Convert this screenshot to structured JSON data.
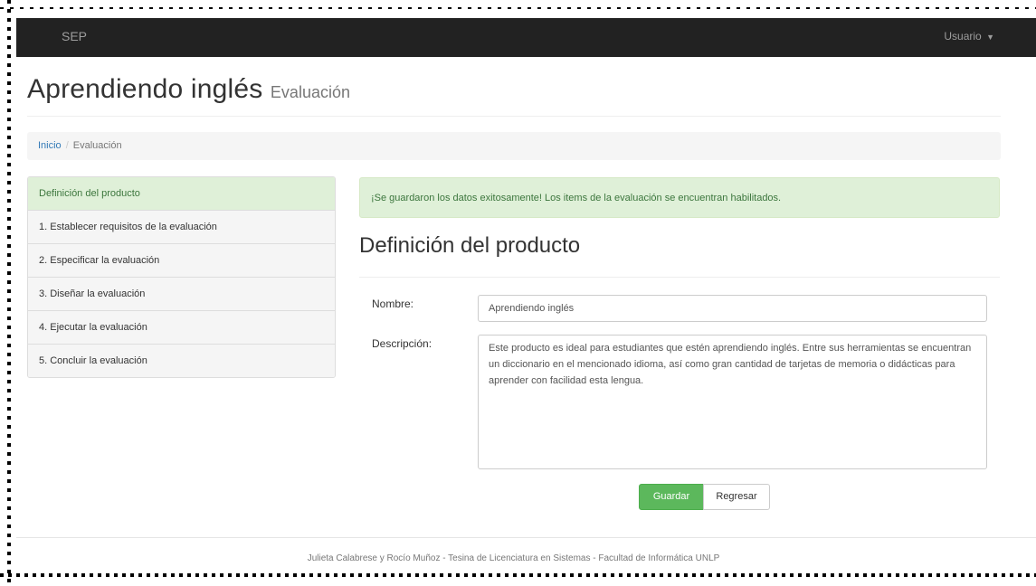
{
  "navbar": {
    "brand": "SEP",
    "user_menu": "Usuario"
  },
  "header": {
    "title": "Aprendiendo inglés",
    "subtitle": "Evaluación"
  },
  "breadcrumb": {
    "home": "Inicio",
    "separator": "/",
    "current": "Evaluación"
  },
  "sidebar": {
    "items": [
      {
        "label": "Definición del producto",
        "active": true
      },
      {
        "label": "1. Establecer requisitos de la evaluación"
      },
      {
        "label": "2. Especificar la evaluación"
      },
      {
        "label": "3. Diseñar la evaluación"
      },
      {
        "label": "4. Ejecutar la evaluación"
      },
      {
        "label": "5. Concluir la evaluación"
      }
    ]
  },
  "alert": {
    "message": "¡Se guardaron los datos exitosamente! Los items de la evaluación se encuentran habilitados."
  },
  "main": {
    "section_title": "Definición del producto",
    "form": {
      "name_label": "Nombre:",
      "name_value": "Aprendiendo inglés",
      "description_label": "Descripción:",
      "description_value": "Este producto es ideal para estudiantes que estén aprendiendo inglés. Entre sus herramientas se encuentran un diccionario en el mencionado idioma, así como gran cantidad de tarjetas de memoria o didácticas para aprender con facilidad esta lengua."
    },
    "buttons": {
      "save": "Guardar",
      "back": "Regresar"
    }
  },
  "footer": {
    "text": "Julieta Calabrese y Rocío Muñoz - Tesina de Licenciatura en Sistemas - Facultad de Informática UNLP"
  },
  "colors": {
    "navbar_bg": "#222222",
    "success_bg": "#dff0d8",
    "success_text": "#3c763d",
    "button_success": "#5cb85c",
    "link": "#337ab7"
  }
}
